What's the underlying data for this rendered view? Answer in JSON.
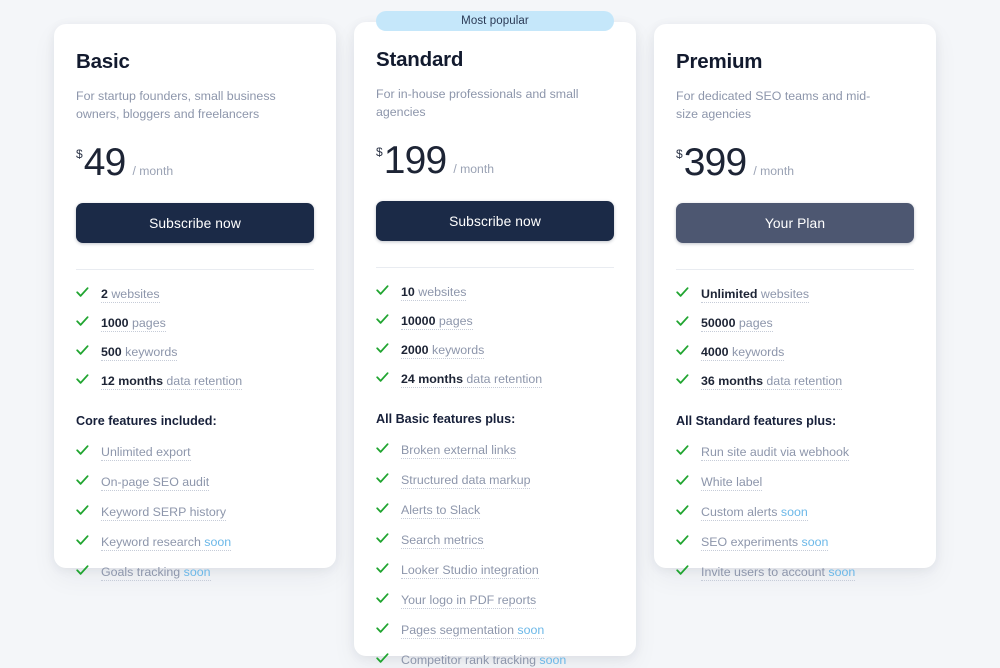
{
  "badge": {
    "most_popular": "Most popular"
  },
  "plans": [
    {
      "id": "basic",
      "name": "Basic",
      "description": "For startup founders, small business owners, bloggers and freelancers",
      "currency": "$",
      "price": "49",
      "period": "/ month",
      "cta_label": "Subscribe now",
      "cta_state": "subscribe",
      "quotas": [
        {
          "value": "2",
          "label": "websites"
        },
        {
          "value": "1000",
          "label": "pages"
        },
        {
          "value": "500",
          "label": "keywords"
        },
        {
          "value": "12 months",
          "label": "data retention"
        }
      ],
      "section_title": "Core features included:",
      "features": [
        {
          "label": "Unlimited export",
          "soon": ""
        },
        {
          "label": "On-page SEO audit",
          "soon": ""
        },
        {
          "label": "Keyword SERP history",
          "soon": ""
        },
        {
          "label": "Keyword research",
          "soon": "soon"
        },
        {
          "label": "Goals tracking",
          "soon": "soon"
        }
      ]
    },
    {
      "id": "standard",
      "name": "Standard",
      "description": "For in-house professionals and small agencies",
      "currency": "$",
      "price": "199",
      "period": "/ month",
      "cta_label": "Subscribe now",
      "cta_state": "subscribe",
      "quotas": [
        {
          "value": "10",
          "label": "websites"
        },
        {
          "value": "10000",
          "label": "pages"
        },
        {
          "value": "2000",
          "label": "keywords"
        },
        {
          "value": "24 months",
          "label": "data retention"
        }
      ],
      "section_title": "All Basic features plus:",
      "features": [
        {
          "label": "Broken external links",
          "soon": ""
        },
        {
          "label": "Structured data markup",
          "soon": ""
        },
        {
          "label": "Alerts to Slack",
          "soon": ""
        },
        {
          "label": "Search metrics",
          "soon": ""
        },
        {
          "label": "Looker Studio integration",
          "soon": ""
        },
        {
          "label": "Your logo in PDF reports",
          "soon": ""
        },
        {
          "label": "Pages segmentation",
          "soon": "soon"
        },
        {
          "label": "Competitor rank tracking",
          "soon": "soon"
        }
      ]
    },
    {
      "id": "premium",
      "name": "Premium",
      "description": "For dedicated SEO teams and mid-size agencies",
      "currency": "$",
      "price": "399",
      "period": "/ month",
      "cta_label": "Your Plan",
      "cta_state": "current",
      "quotas": [
        {
          "value": "Unlimited",
          "label": "websites"
        },
        {
          "value": "50000",
          "label": "pages"
        },
        {
          "value": "4000",
          "label": "keywords"
        },
        {
          "value": "36 months",
          "label": "data retention"
        }
      ],
      "section_title": "All Standard features plus:",
      "features": [
        {
          "label": "Run site audit via webhook",
          "soon": ""
        },
        {
          "label": "White label",
          "soon": ""
        },
        {
          "label": "Custom alerts",
          "soon": "soon"
        },
        {
          "label": "SEO experiments",
          "soon": "soon"
        },
        {
          "label": "Invite users to account",
          "soon": "soon"
        }
      ]
    }
  ],
  "colors": {
    "page_background": "#f4f6f9",
    "card_background": "#ffffff",
    "cta_primary": "#1b2a47",
    "cta_current": "#4d5771",
    "badge_background": "#c5e7fa",
    "check_green": "#21a531",
    "soon_blue": "#6cb8e8",
    "muted_text": "#8d96ab",
    "heading_text": "#121a2e"
  }
}
